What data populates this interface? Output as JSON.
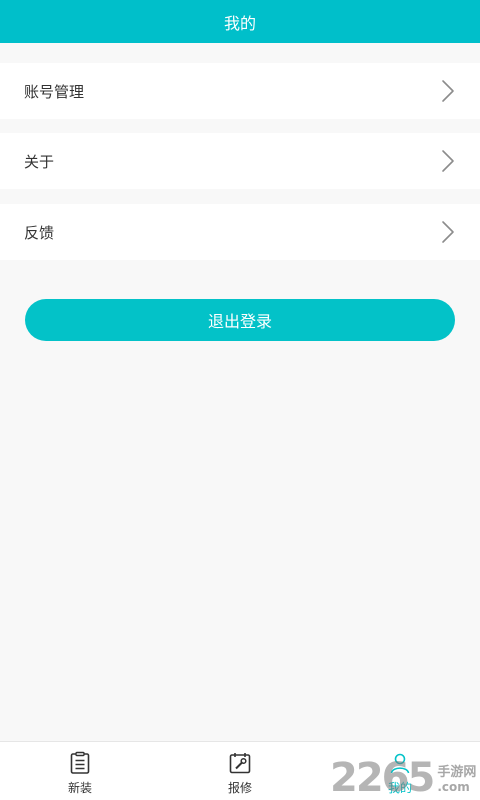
{
  "header": {
    "title": "我的"
  },
  "menu": {
    "items": [
      {
        "label": "账号管理"
      },
      {
        "label": "关于"
      },
      {
        "label": "反馈"
      }
    ]
  },
  "logout": {
    "label": "退出登录"
  },
  "tabbar": {
    "tabs": [
      {
        "label": "新装",
        "icon": "clipboard-icon"
      },
      {
        "label": "报修",
        "icon": "repair-calendar-icon"
      },
      {
        "label": "我的",
        "icon": "user-icon",
        "active": true
      }
    ]
  },
  "watermark": {
    "number": "2265",
    "text_cn": "手游网",
    "text_com": ".com"
  },
  "colors": {
    "accent": "#00bfca",
    "button": "#03c2c8",
    "background": "#f8f8f8"
  }
}
